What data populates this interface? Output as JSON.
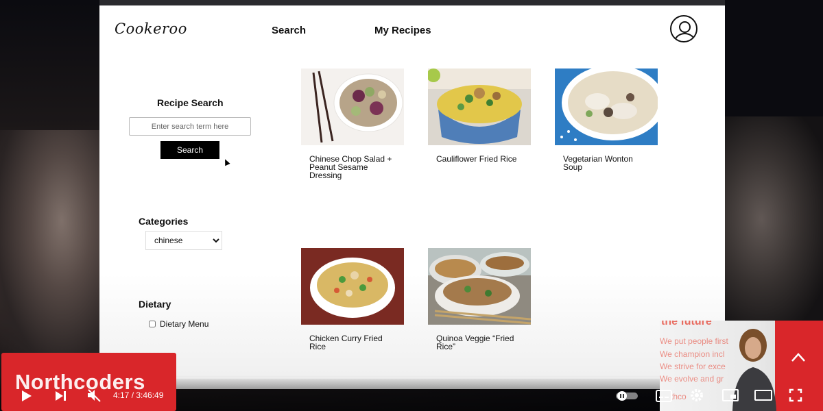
{
  "app": {
    "logo": "Cookeroo",
    "nav": {
      "search": "Search",
      "my_recipes": "My Recipes"
    }
  },
  "sidebar": {
    "search_title": "Recipe Search",
    "search_placeholder": "Enter search term here",
    "search_button": "Search",
    "categories_title": "Categories",
    "category_selected": "chinese",
    "dietary_title": "Dietary",
    "dietary_option": "Dietary Menu"
  },
  "recipes": [
    {
      "title": "Chinese Chop Salad + Peanut Sesame Dressing"
    },
    {
      "title": "Cauliflower Fried Rice"
    },
    {
      "title": "Vegetarian Wonton Soup"
    },
    {
      "title": "Chicken Curry Fried Rice"
    },
    {
      "title": "Quinoa Veggie “Fried Rice”"
    }
  ],
  "player": {
    "time": "4:17 / 3:46:49",
    "progress_fraction": 0.019,
    "channel_logo": "Northcoders",
    "pip_heading": "the future",
    "pip_lines": [
      "We put people first",
      "We champion incl",
      "We strive for exce",
      "We evolve and gr",
      "thco"
    ]
  },
  "colors": {
    "accent_red": "#d9262a",
    "progress_red": "#ff0000",
    "button_black": "#000000"
  }
}
